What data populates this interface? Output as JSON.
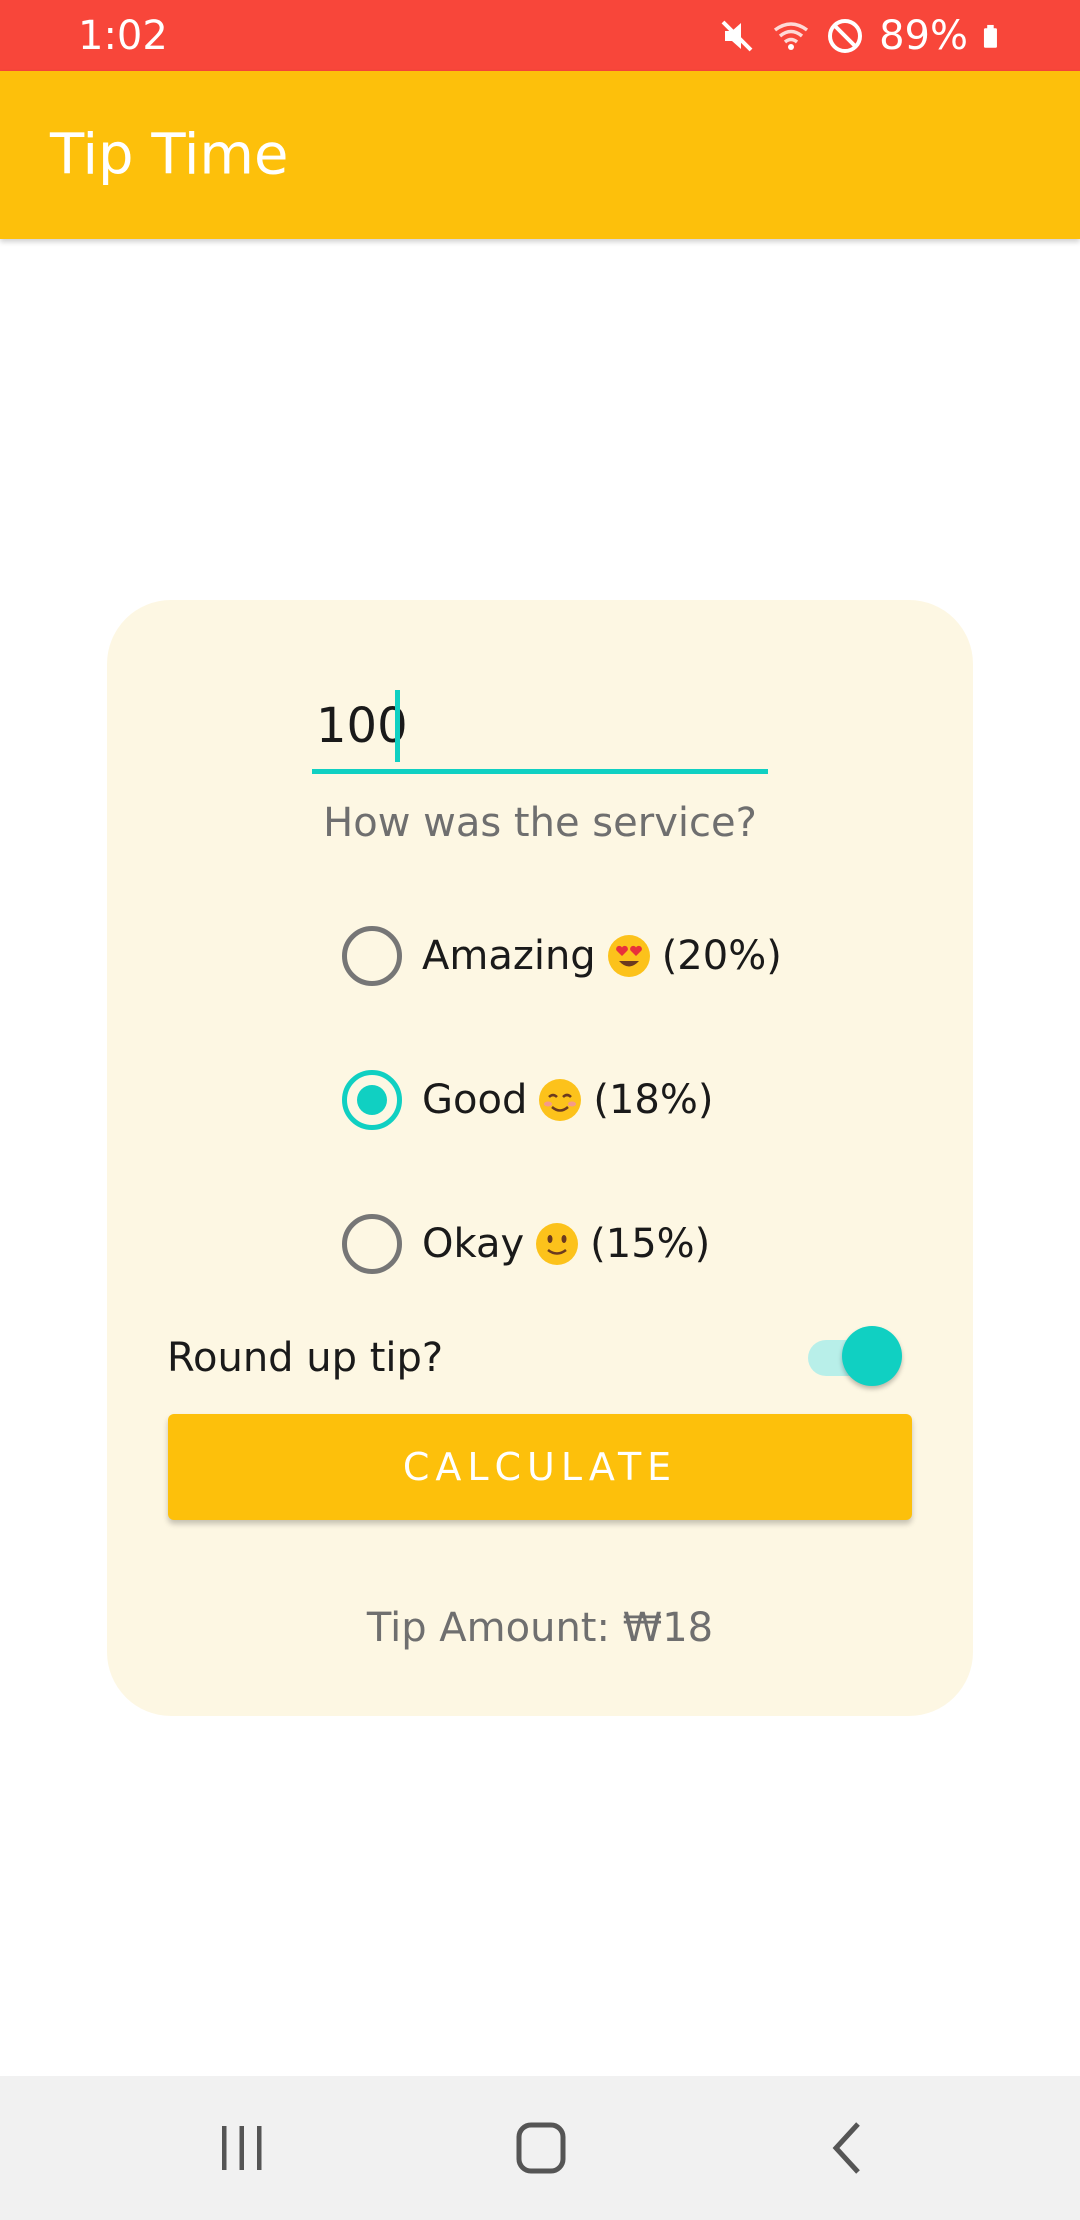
{
  "status_bar": {
    "time": "1:02",
    "battery_percent": "89%",
    "icons": [
      "mute-icon",
      "wifi-icon",
      "do-not-disturb-icon",
      "battery-icon"
    ],
    "background": "#f8463a"
  },
  "app_bar": {
    "title": "Tip Time",
    "background": "#fdc00b"
  },
  "form": {
    "amount_value": "100",
    "question": "How was the service?",
    "options": [
      {
        "label": "Amazing",
        "percent": "(20%)",
        "emoji": "heart-eyes-emoji",
        "selected": false
      },
      {
        "label": "Good",
        "percent": "(18%)",
        "emoji": "smiling-blush-emoji",
        "selected": true
      },
      {
        "label": "Okay",
        "percent": "(15%)",
        "emoji": "slight-smile-emoji",
        "selected": false
      }
    ],
    "round_up_label": "Round up tip?",
    "round_up_on": true,
    "calculate_label": "CALCULATE",
    "tip_result": "Tip Amount: ₩18"
  },
  "colors": {
    "accent": "#10d0c2",
    "primary": "#fdc00b",
    "card_bg": "#fdf7e3"
  },
  "nav_bar": {
    "buttons": [
      "recent-apps-icon",
      "home-icon",
      "back-icon"
    ]
  }
}
